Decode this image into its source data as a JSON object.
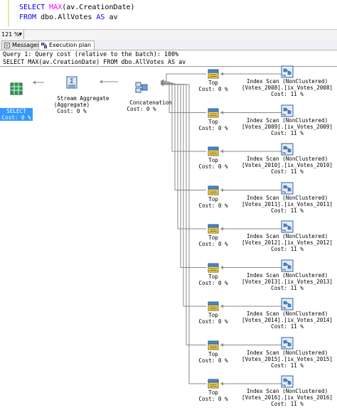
{
  "editor": {
    "line1": {
      "kw": "SELECT",
      "fn": "MAX",
      "rest": "(av.CreationDate)"
    },
    "line2": {
      "kw1": "FROM",
      "mid": " dbo.AllVotes ",
      "kw2": "AS",
      "rest": " av"
    }
  },
  "zoom": {
    "value": "121 %"
  },
  "tabs": [
    {
      "label": "Messages",
      "icon": "messages-icon",
      "active": false
    },
    {
      "label": "Execution plan",
      "icon": "execution-plan-icon",
      "active": true
    }
  ],
  "plan": {
    "header_line1": "Query 1: Query cost (relative to the batch): 100%",
    "header_line2": "SELECT MAX(av.CreationDate) FROM dbo.AllVotes AS av",
    "select": {
      "name": "SELECT",
      "cost": "Cost: 0 %"
    },
    "stream_aggregate": {
      "name": "Stream Aggregate",
      "sub": "(Aggregate)",
      "cost": "Cost: 0 %"
    },
    "concatenation": {
      "name": "Concatenation",
      "cost": "Cost: 0 %"
    },
    "branches": [
      {
        "top_name": "Top",
        "top_cost": "Cost: 0 %",
        "scan_name": "Index Scan (NonClustered)",
        "scan_obj": "[Votes_2008].[ix_Votes_2008]",
        "scan_cost": "Cost: 11 %"
      },
      {
        "top_name": "Top",
        "top_cost": "Cost: 0 %",
        "scan_name": "Index Scan (NonClustered)",
        "scan_obj": "[Votes_2009].[ix_Votes_2009]",
        "scan_cost": "Cost: 11 %"
      },
      {
        "top_name": "Top",
        "top_cost": "Cost: 0 %",
        "scan_name": "Index Scan (NonClustered)",
        "scan_obj": "[Votes_2010].[ix_Votes_2010]",
        "scan_cost": "Cost: 11 %"
      },
      {
        "top_name": "Top",
        "top_cost": "Cost: 0 %",
        "scan_name": "Index Scan (NonClustered)",
        "scan_obj": "[Votes_2011].[ix_Votes_2011]",
        "scan_cost": "Cost: 11 %"
      },
      {
        "top_name": "Top",
        "top_cost": "Cost: 0 %",
        "scan_name": "Index Scan (NonClustered)",
        "scan_obj": "[Votes_2012].[ix_Votes_2012]",
        "scan_cost": "Cost: 11 %"
      },
      {
        "top_name": "Top",
        "top_cost": "Cost: 0 %",
        "scan_name": "Index Scan (NonClustered)",
        "scan_obj": "[Votes_2013].[ix_Votes_2013]",
        "scan_cost": "Cost: 11 %"
      },
      {
        "top_name": "Top",
        "top_cost": "Cost: 0 %",
        "scan_name": "Index Scan (NonClustered)",
        "scan_obj": "[Votes_2014].[ix_Votes_2014]",
        "scan_cost": "Cost: 11 %"
      },
      {
        "top_name": "Top",
        "top_cost": "Cost: 0 %",
        "scan_name": "Index Scan (NonClustered)",
        "scan_obj": "[Votes_2015].[ix_Votes_2015]",
        "scan_cost": "Cost: 11 %"
      },
      {
        "top_name": "Top",
        "top_cost": "Cost: 0 %",
        "scan_name": "Index Scan (NonClustered)",
        "scan_obj": "[Votes_2016].[ix_Votes_2016]",
        "scan_cost": "Cost: 11 %"
      }
    ]
  },
  "colors": {
    "keyword": "#0000ff",
    "function": "#ff00ff",
    "selected": "#3399ff"
  }
}
